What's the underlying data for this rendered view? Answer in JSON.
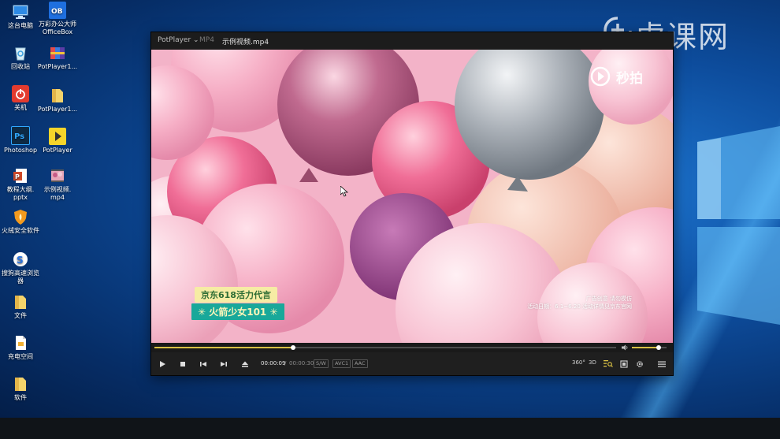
{
  "desktop": {
    "icons": [
      {
        "label": "这台电脑",
        "icon": "computer-icon"
      },
      {
        "label": "万彩办公大师\nOfficeBox",
        "icon": "officebox-icon"
      },
      {
        "label": "回收站",
        "icon": "recycle-bin-icon"
      },
      {
        "label": "PotPlayer1...",
        "icon": "zip-archive-icon"
      },
      {
        "label": "关机",
        "icon": "power-icon"
      },
      {
        "label": "PotPlayer1...",
        "icon": "folder-icon"
      },
      {
        "label": "Photoshop",
        "icon": "photoshop-icon"
      },
      {
        "label": "PotPlayer",
        "icon": "potplayer-icon"
      },
      {
        "label": "教程大纲.\npptx",
        "icon": "pptx-file-icon"
      },
      {
        "label": "示例视频.\nmp4",
        "icon": "video-file-icon"
      },
      {
        "label": "火绒安全软件",
        "icon": "huorong-shield-icon"
      },
      {
        "label": "搜狗高速浏览\n器",
        "icon": "sogou-browser-icon"
      },
      {
        "label": "文件",
        "icon": "folder-icon"
      },
      {
        "label": "充电空间",
        "icon": "document-file-icon"
      },
      {
        "label": "软件",
        "icon": "folder-icon"
      }
    ],
    "watermark": {
      "brand": "虎课网"
    }
  },
  "player": {
    "app_menu": "PotPlayer ⌄",
    "format": "MP4",
    "file_title": "示例视频.mp4",
    "video": {
      "watermark": "秒拍",
      "promo_line1": "京东618活力代言",
      "promo_line2": "✳ 火箭少女101 ✳",
      "ad_line1": "广告创意 请勿模仿",
      "ad_line2": "活动日期：6.1~6.20 活动详情见京东官网"
    },
    "seek": {
      "progress": 0.3,
      "volume": 0.78
    },
    "time_current": "00:00:09",
    "time_separator": "/",
    "time_total": "00:00:30",
    "tags": [
      "S/W",
      "AVC1",
      "AAC"
    ],
    "right_labels": {
      "deg360": "360°",
      "three_d": "3D"
    }
  },
  "colors": {
    "accent": "#d8c044",
    "player_bg": "#1f1f1f",
    "desktop_blue": "#0d4c9c",
    "promo_green": "#19a89a"
  }
}
